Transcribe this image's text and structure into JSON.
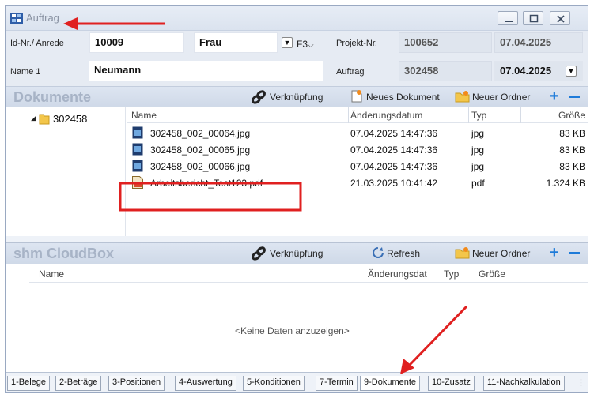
{
  "window": {
    "title": "Auftrag"
  },
  "form": {
    "id_label": "Id-Nr./ Anrede",
    "id_value": "10009",
    "salutation": "Frau",
    "f3_label": "F3",
    "projekt_label": "Projekt-Nr.",
    "projekt_value": "100652",
    "projekt_date": "07.04.2025",
    "name_label": "Name 1",
    "name_value": "Neumann",
    "auftrag_label": "Auftrag",
    "auftrag_value": "302458",
    "auftrag_date": "07.04.2025"
  },
  "dokumente": {
    "title": "Dokumente",
    "toolbar": {
      "link": "Verknüpfung",
      "new_doc": "Neues Dokument",
      "new_folder": "Neuer Ordner"
    },
    "tree_root": "302458",
    "columns": {
      "name": "Name",
      "date": "Änderungsdatum",
      "type": "Typ",
      "size": "Größe"
    },
    "files": [
      {
        "name": "302458_002_00064.jpg",
        "date": "07.04.2025 14:47:36",
        "type": "jpg",
        "size": "83 KB"
      },
      {
        "name": "302458_002_00065.jpg",
        "date": "07.04.2025 14:47:36",
        "type": "jpg",
        "size": "83 KB"
      },
      {
        "name": "302458_002_00066.jpg",
        "date": "07.04.2025 14:47:36",
        "type": "jpg",
        "size": "83 KB"
      },
      {
        "name": "Arbeitsbericht_Test123.pdf",
        "date": "21.03.2025 10:41:42",
        "type": "pdf",
        "size": "1.324 KB"
      }
    ]
  },
  "cloudbox": {
    "title": "shm CloudBox",
    "toolbar": {
      "link": "Verknüpfung",
      "refresh": "Refresh",
      "new_folder": "Neuer Ordner"
    },
    "columns": {
      "name": "Name",
      "date": "Änderungsdat",
      "type": "Typ",
      "size": "Größe"
    },
    "empty": "<Keine Daten anzuzeigen>"
  },
  "tabs": [
    {
      "label": "1-Belege"
    },
    {
      "label": "2-Beträge"
    },
    {
      "label": "3-Positionen"
    },
    {
      "label": "4-Auswertung"
    },
    {
      "label": "5-Konditionen"
    },
    {
      "label": "7-Termin"
    },
    {
      "label": "9-Dokumente"
    },
    {
      "label": "10-Zusatz"
    },
    {
      "label": "11-Nachkalkulation"
    }
  ],
  "colors": {
    "annotation": "#e02020",
    "accent": "#1e7bd9",
    "header_text": "#a7b3c6"
  }
}
